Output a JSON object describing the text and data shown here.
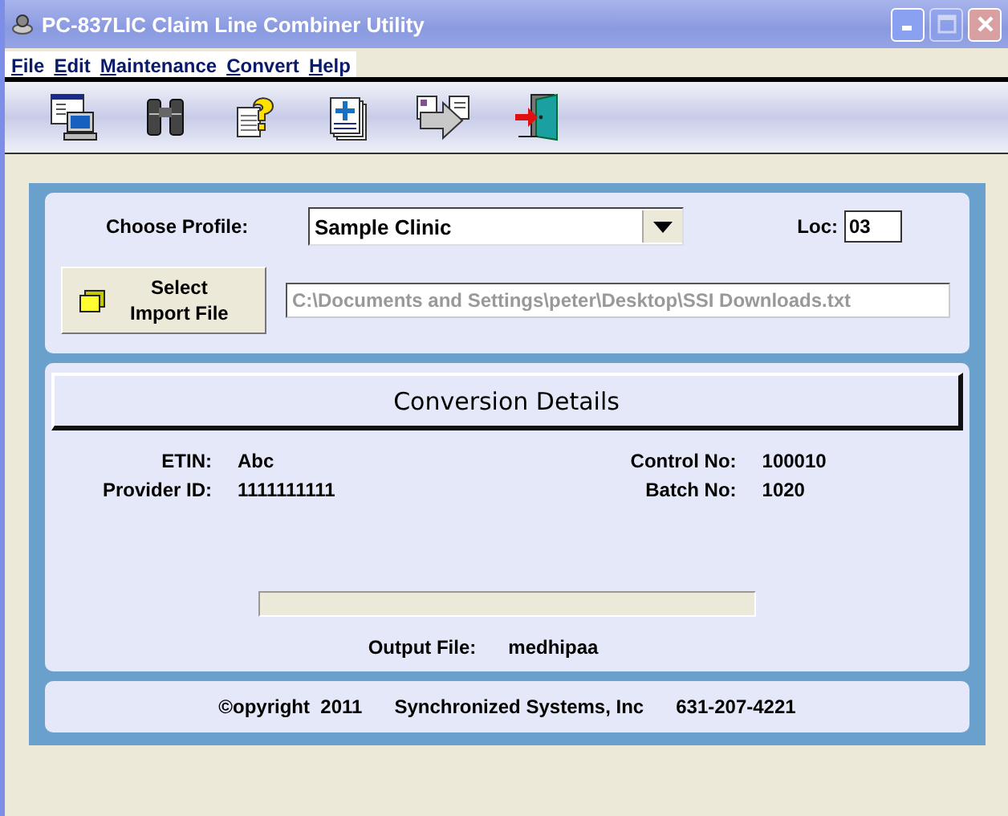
{
  "window": {
    "title": "PC-837LIC Claim Line Combiner Utility",
    "maximize_disabled": true
  },
  "menu": [
    "File",
    "Edit",
    "Maintenance",
    "Convert",
    "Help"
  ],
  "toolbar": [
    {
      "kind": "screen"
    },
    {
      "kind": "binoculars"
    },
    {
      "kind": "help"
    },
    {
      "kind": "add"
    },
    {
      "kind": "send"
    },
    {
      "kind": "exit"
    }
  ],
  "profile": {
    "label": "Choose Profile:",
    "value": "Sample Clinic"
  },
  "loc": {
    "label": "Loc:",
    "value": "03"
  },
  "import": {
    "button": [
      "Select",
      "Import File"
    ],
    "path": "C:\\Documents and Settings\\peter\\Desktop\\SSI Downloads.txt"
  },
  "details": {
    "heading": "Conversion Details",
    "left": [
      {
        "label": "ETIN:",
        "value": "Abc"
      },
      {
        "label": "Provider ID:",
        "value": "1111111111"
      }
    ],
    "right": [
      {
        "label": "Control No:",
        "value": "100010"
      },
      {
        "label": "Batch No:",
        "value": "1020"
      }
    ],
    "progress": {
      "level": 0
    },
    "output": {
      "label": "Output File:",
      "value": "medhipaa"
    }
  },
  "footer": [
    "©opyright  2011",
    "Synchronized Systems, Inc",
    "631-207-4221"
  ]
}
